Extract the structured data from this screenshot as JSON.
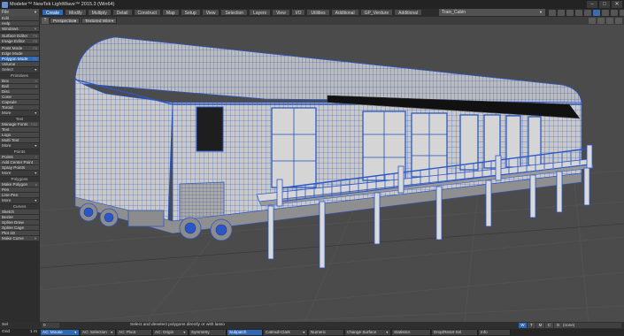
{
  "window": {
    "title": "Modeler™ NewTek LightWave™ 2015.3 (Win64)",
    "controls": [
      "–",
      "□",
      "✕"
    ]
  },
  "menu": {
    "file": "File",
    "tabs": [
      "Create",
      "Modify",
      "Multiply",
      "Detail",
      "Construct",
      "Map",
      "Setup",
      "View",
      "Selection",
      "Layers",
      "View",
      "I/O",
      "Utilities",
      "Additional",
      "GP_Verdure",
      "Additional"
    ],
    "active_tab": 0,
    "object_name": "Train_Cabin"
  },
  "sidebar": {
    "top": [
      {
        "label": "Edit"
      },
      {
        "label": "Help"
      },
      {
        "label": "Windows"
      }
    ],
    "windows": [
      {
        "label": "Surface Editor",
        "key": "F5"
      },
      {
        "label": "Image Editor",
        "key": "F6"
      }
    ],
    "modes": [
      {
        "label": "Point Mode",
        "key": "F8",
        "active": false
      },
      {
        "label": "Edge Mode",
        "key": "",
        "active": false
      },
      {
        "label": "Polygon Mode",
        "key": "F1",
        "active": true
      },
      {
        "label": "Volume",
        "key": "",
        "active": false
      }
    ],
    "select": "Select",
    "primitives_head": "Primitives",
    "primitives": [
      {
        "label": "Box",
        "key": "X"
      },
      {
        "label": "Ball",
        "key": "0"
      },
      {
        "label": "Disc",
        "key": ""
      },
      {
        "label": "Cone",
        "key": ""
      },
      {
        "label": "Capsule",
        "key": ""
      },
      {
        "label": "Toroid",
        "key": ""
      }
    ],
    "more": "More",
    "text_head": "Text",
    "text": [
      {
        "label": "Manage Fonts",
        "key": "F10"
      },
      {
        "label": "Text",
        "key": ""
      },
      {
        "label": "Logo",
        "key": ""
      },
      {
        "label": "Multi Text",
        "key": ""
      }
    ],
    "points_head": "Points",
    "points": [
      {
        "label": "Points",
        "key": "+"
      },
      {
        "label": "Add Center Point",
        "key": ""
      },
      {
        "label": "Spray Points",
        "key": ""
      }
    ],
    "polygons_head": "Polygons",
    "polygons": [
      {
        "label": "Make Polygon",
        "key": "p"
      },
      {
        "label": "Pen",
        "key": ""
      },
      {
        "label": "Line Pen",
        "key": ""
      }
    ],
    "curves_head": "Curves",
    "curves": [
      {
        "label": "Sketch",
        "key": ""
      },
      {
        "label": "Bezier",
        "key": ""
      },
      {
        "label": "Spline Draw",
        "key": ""
      },
      {
        "label": "Spline Cage",
        "key": ""
      },
      {
        "label": "Plot 1D",
        "key": ""
      },
      {
        "label": "Make Curve",
        "key": ""
      }
    ]
  },
  "viewport": {
    "view": "Perspective",
    "render": "Textured Wire",
    "toggle": "?"
  },
  "status": {
    "sel_label": "Sel",
    "sel_value": "0",
    "hint": "Select and deselect polygons directly or with lasso",
    "modes": [
      "W",
      "T",
      "M",
      "C",
      "S"
    ],
    "active_mode": 0,
    "layer": "(none)"
  },
  "bottom": {
    "grid_label": "Grid",
    "grid_value": "1 m",
    "buttons": [
      {
        "label": "AC: Mouse",
        "active": true,
        "arrow": true
      },
      {
        "label": "AC: Selection",
        "active": false,
        "arrow": true
      },
      {
        "label": "AC: Pivot",
        "active": false,
        "arrow": false
      },
      {
        "label": "AC: Origin",
        "active": false,
        "arrow": true
      },
      {
        "label": "Symmetry",
        "active": false,
        "arrow": false
      },
      {
        "label": "Subpatch",
        "active": true,
        "arrow": false
      },
      {
        "label": "Catmull-Clark",
        "active": false,
        "arrow": true
      },
      {
        "label": "Numeric",
        "active": false,
        "arrow": false
      },
      {
        "label": "Change Surface",
        "active": false,
        "arrow": true
      },
      {
        "label": "Statistics",
        "active": false,
        "arrow": false
      },
      {
        "label": "Drop/Reset Sel",
        "active": false,
        "arrow": false
      },
      {
        "label": "Info",
        "active": false,
        "arrow": false
      }
    ]
  },
  "colors": {
    "accent": "#2f69b3",
    "wire": "#2b56c8",
    "surface": "#c7c7c7",
    "viewport_bg": "#4b4b4b"
  }
}
